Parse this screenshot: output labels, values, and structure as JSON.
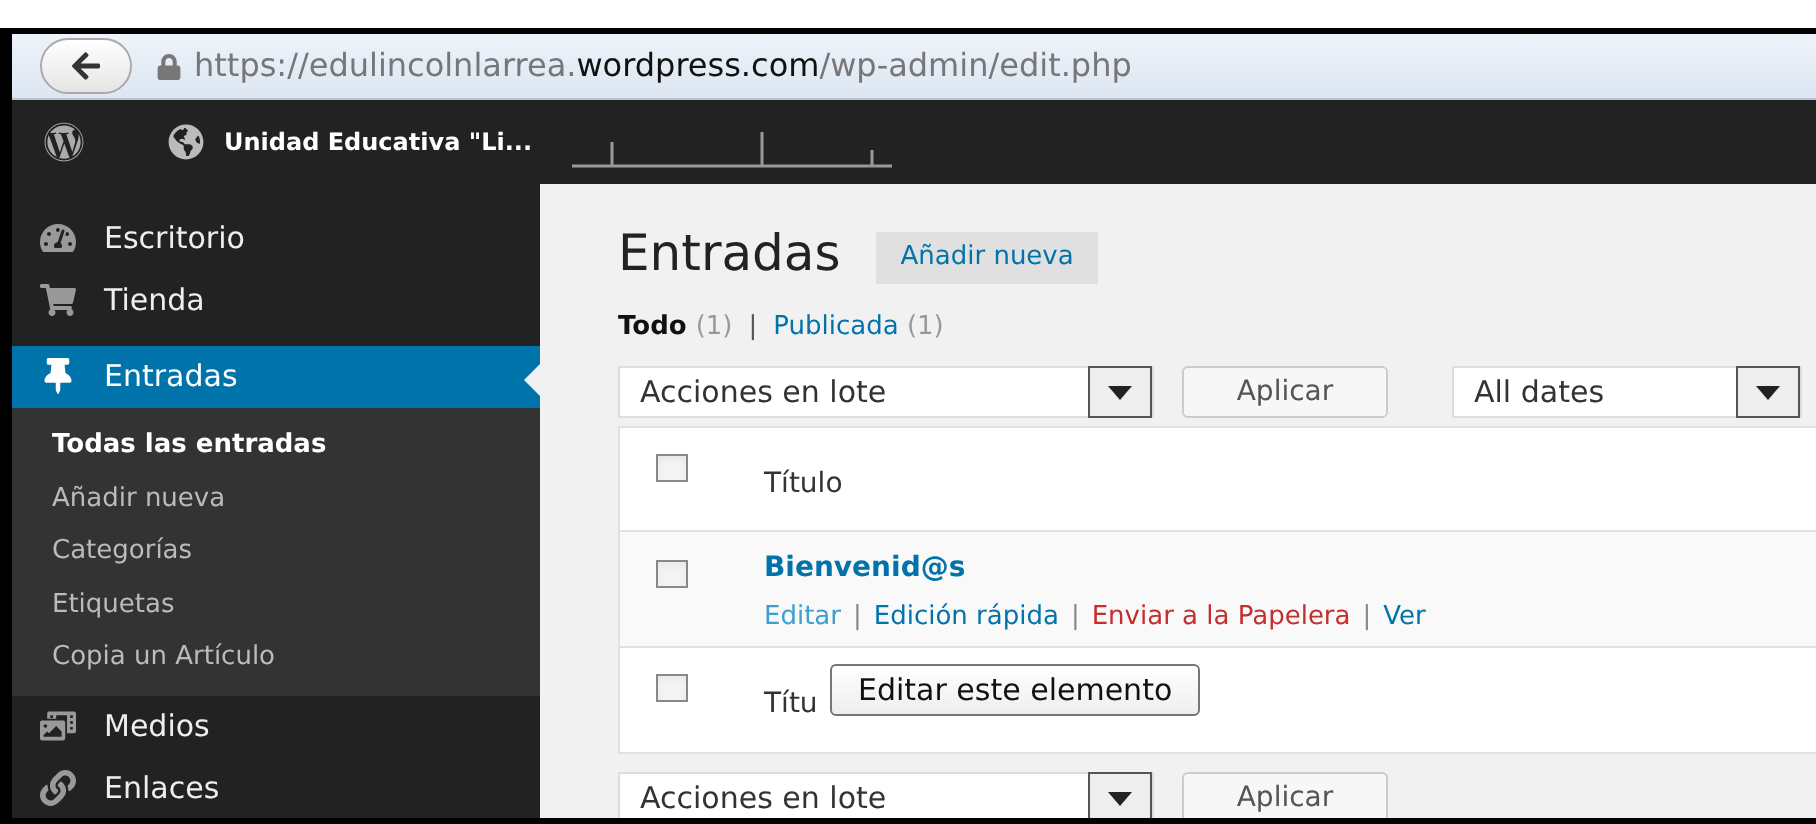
{
  "browser": {
    "url": [
      {
        "text": "https://edulincolnlarrea.",
        "kind": "dim"
      },
      {
        "text": "wordpress.com",
        "kind": "strong"
      },
      {
        "text": "/wp-admin/edit.php",
        "kind": "dim"
      }
    ]
  },
  "admin_bar": {
    "site_name": "Unidad Educativa \"Li..."
  },
  "sidebar": {
    "items": [
      {
        "label": "Escritorio",
        "selected": false
      },
      {
        "label": "Tienda",
        "selected": false
      },
      {
        "label": "Entradas",
        "selected": true,
        "children": [
          {
            "label": "Todas las entradas",
            "selected": true
          },
          {
            "label": "Añadir nueva",
            "selected": false
          },
          {
            "label": "Categorías",
            "selected": false
          },
          {
            "label": "Etiquetas",
            "selected": false
          },
          {
            "label": "Copia un Artículo",
            "selected": false
          }
        ]
      },
      {
        "label": "Medios",
        "selected": false
      },
      {
        "label": "Enlaces",
        "selected": false
      }
    ]
  },
  "main": {
    "title": "Entradas",
    "add_button": "Añadir nueva",
    "filters": [
      {
        "label": "Todo",
        "count": "(1)",
        "selected": true
      },
      {
        "label": "Publicada",
        "count": "(1)",
        "selected": false
      }
    ],
    "filter_separator": "|",
    "top_actions": {
      "bulk_select": "Acciones en lote",
      "apply": "Aplicar",
      "date_select": "All dates"
    },
    "table": {
      "header": {
        "title": "Título",
        "checked": false
      },
      "rows": [
        {
          "title": "Bienvenid@s",
          "checked": false,
          "action_separator": "|",
          "actions": [
            {
              "label": "Editar",
              "kind": "edit"
            },
            {
              "label": "Edición rápida",
              "kind": "link"
            },
            {
              "label": "Enviar a la Papelera",
              "kind": "danger"
            },
            {
              "label": "Ver",
              "kind": "link"
            }
          ]
        }
      ],
      "footer": {
        "title": "Títu",
        "checked": false
      }
    },
    "tooltip": "Editar este elemento",
    "bottom_actions": {
      "bulk_select": "Acciones en lote",
      "apply": "Aplicar"
    }
  }
}
